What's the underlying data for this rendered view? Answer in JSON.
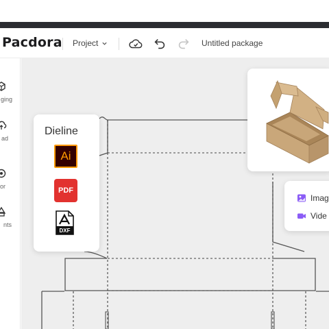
{
  "app": {
    "logo": "Pacdora",
    "project_menu": "Project",
    "document_title": "Untitled package"
  },
  "sidebar": {
    "items": [
      {
        "label": "ging",
        "icon": "packaging-icon"
      },
      {
        "label": "ad",
        "icon": "upload-icon"
      },
      {
        "label": "or",
        "icon": "color-icon"
      },
      {
        "label": "nts",
        "icon": "elements-icon"
      }
    ]
  },
  "dieline_panel": {
    "title": "Dieline",
    "formats": [
      {
        "label": "Ai",
        "icon": "ai-file-icon"
      },
      {
        "label": "PDF",
        "icon": "pdf-file-icon"
      },
      {
        "label": "DXF",
        "icon": "dxf-file-icon"
      }
    ]
  },
  "media_panel": {
    "items": [
      {
        "label": "Imag",
        "icon": "image-icon"
      },
      {
        "label": "Vide",
        "icon": "video-icon"
      }
    ]
  },
  "colors": {
    "accent": "#8b5cf6",
    "ai_orange": "#ff9a00",
    "pdf_red": "#e2322f",
    "darkbar": "#2b2d31",
    "cardboard": "#c9a77a"
  }
}
